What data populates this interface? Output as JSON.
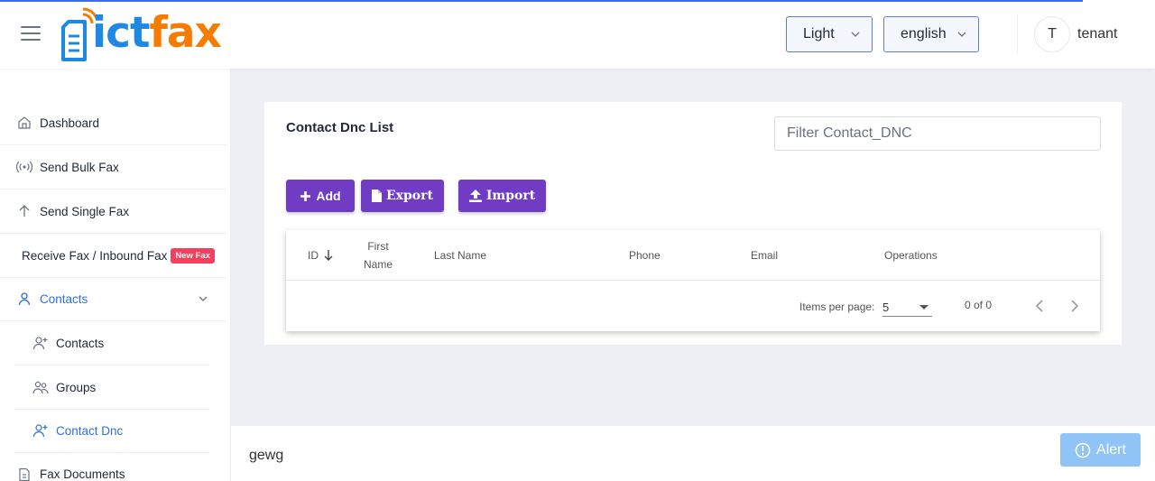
{
  "header": {
    "logo_ict": "ict",
    "logo_fax": "fax",
    "theme_label": "Light",
    "language_label": "english",
    "user_initial": "T",
    "user_name": "tenant"
  },
  "sidebar": {
    "items": [
      {
        "label": "Dashboard",
        "icon": "home-icon"
      },
      {
        "label": "Send Bulk Fax",
        "icon": "broadcast-icon"
      },
      {
        "label": "Send Single Fax",
        "icon": "arrow-up-icon"
      },
      {
        "label": "Receive Fax / Inbound Fax",
        "badge": "New Fax"
      },
      {
        "label": "Contacts",
        "icon": "user-icon",
        "expanded": true
      },
      {
        "label": "Fax Documents",
        "icon": "document-icon"
      }
    ],
    "contacts_sub": [
      {
        "label": "Contacts",
        "icon": "user-plus-icon"
      },
      {
        "label": "Groups",
        "icon": "users-icon"
      },
      {
        "label": "Contact Dnc",
        "icon": "user-plus-icon"
      }
    ]
  },
  "main": {
    "title": "Contact Dnc List",
    "filter_placeholder": "Filter Contact_DNC",
    "buttons": {
      "add": "Add",
      "export": "Export",
      "import": "Import"
    },
    "table": {
      "columns": {
        "id": "ID",
        "first_name": "First Name",
        "last_name": "Last Name",
        "phone": "Phone",
        "email": "Email",
        "operations": "Operations"
      },
      "rows": []
    },
    "paginator": {
      "items_per_page_label": "Items per page:",
      "items_per_page": "5",
      "range_label": "0 of 0"
    }
  },
  "footer": {
    "text": "gewg",
    "alert_label": "Alert"
  },
  "colors": {
    "primary_purple": "#6f3cc3",
    "active_blue": "#2f6fdb",
    "badge_pink": "#f43f5e",
    "logo_blue": "#1e88e5",
    "logo_orange": "#f57c00",
    "alert_blue": "#90c4f6"
  }
}
